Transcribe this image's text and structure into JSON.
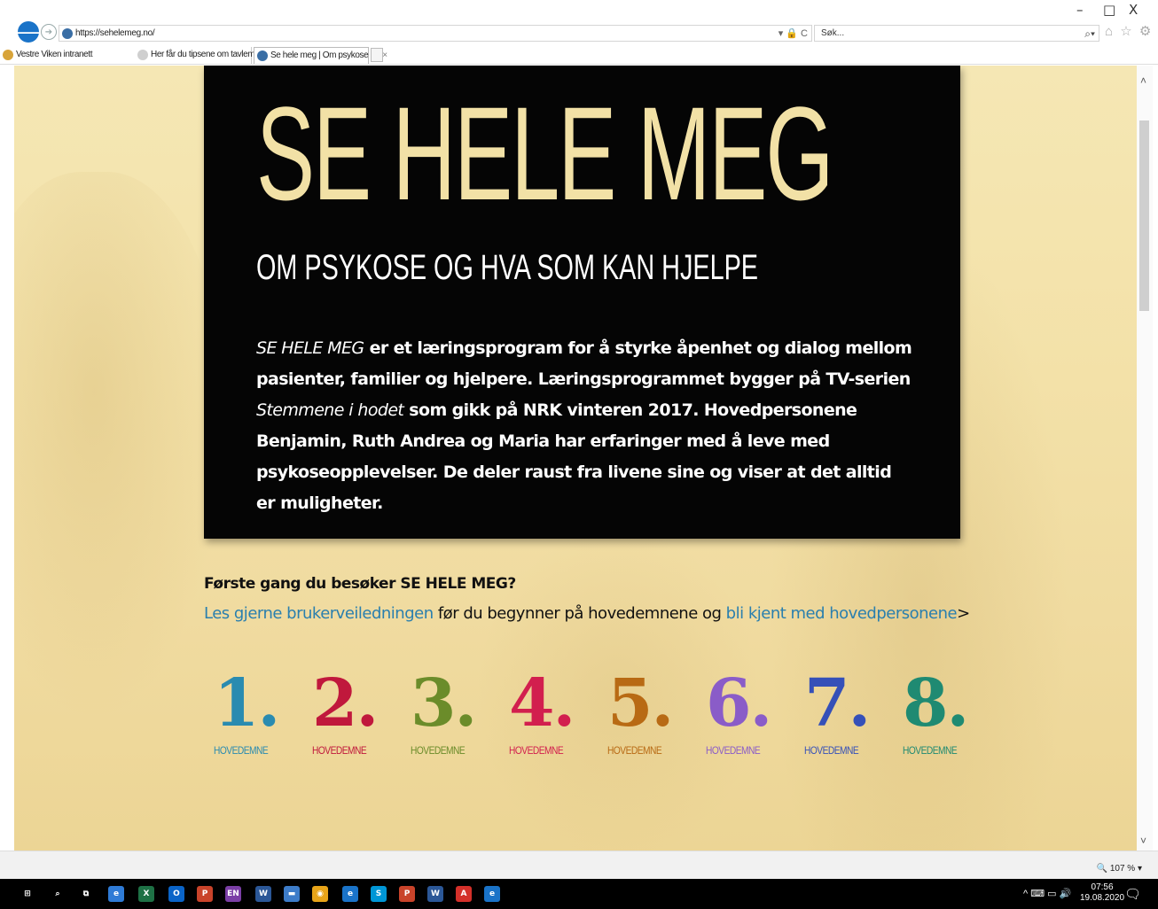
{
  "window_controls": {
    "minimize": "–",
    "maximize": "□",
    "close": "X"
  },
  "browser": {
    "url": "https://sehelemeg.no/",
    "address_controls": "▾ 🔒 C",
    "search_placeholder": "Søk...",
    "search_icon": "search-icon",
    "toolbar_icons": "⌂ ☆ ⚙",
    "tabs": [
      {
        "label": "Vestre Viken intranett",
        "icon": "ie-icon",
        "color": "#d8a43a"
      },
      {
        "label": "Her får du tipsene om tavlemø...",
        "icon": "page-icon",
        "color": "#aaaaaa"
      },
      {
        "label": "Se hele meg | Om psykose ...",
        "icon": "wordpress-icon",
        "color": "#3a6ea5",
        "active": true,
        "close": "×"
      }
    ]
  },
  "hero": {
    "title": "SE HELE MEG",
    "subtitle": "OM PSYKOSE OG HVA SOM KAN HJELPE",
    "text": {
      "p1_italic": "SE HELE MEG",
      "p2": " er et læringsprogram for å styrke åpenhet og dialog mellom pasienter, familier og hjelpere. Læringsprogrammet bygger på TV-serien ",
      "p3_italic": "Stemmene i hodet",
      "p4": " som gikk på NRK vinteren 2017. Hovedpersonene Benjamin, Ruth Andrea og Maria har erfaringer med å leve med psykoseopplevelser. De deler raust fra livene sine og viser at det alltid er muligheter."
    }
  },
  "intro": {
    "question": "Første gang du besøker SE HELE MEG?",
    "link1": "Les gjerne brukerveiledningen",
    "mid": " før du begynner på hovedemnene og ",
    "link2": "bli kjent med hovedpersonene",
    "arrow": ">"
  },
  "topics": [
    {
      "number": "1.",
      "label": "HOVEDEMNE",
      "color": "#2a8bb0"
    },
    {
      "number": "2.",
      "label": "HOVEDEMNE",
      "color": "#c0183c"
    },
    {
      "number": "3.",
      "label": "HOVEDEMNE",
      "color": "#6b8c2a"
    },
    {
      "number": "4.",
      "label": "HOVEDEMNE",
      "color": "#d21f4e"
    },
    {
      "number": "5.",
      "label": "HOVEDEMNE",
      "color": "#b86a14"
    },
    {
      "number": "6.",
      "label": "HOVEDEMNE",
      "color": "#8a5cc8"
    },
    {
      "number": "7.",
      "label": "HOVEDEMNE",
      "color": "#3550b8"
    },
    {
      "number": "8.",
      "label": "HOVEDEMNE",
      "color": "#1f8a72"
    }
  ],
  "statusbar": {
    "zoom": "🔍 107 %  ▾"
  },
  "taskbar": {
    "tray": "^ ⌨ ▭ 🔊",
    "time": "07:56",
    "date": "19.08.2020",
    "notifications": "🗨",
    "apps": [
      {
        "name": "windows-start-icon",
        "glyph": "⊞",
        "color": "#000000"
      },
      {
        "name": "search-icon",
        "glyph": "⌕",
        "color": "#000000"
      },
      {
        "name": "task-view-icon",
        "glyph": "⧉",
        "color": "#000000"
      },
      {
        "name": "edge-icon",
        "glyph": "e",
        "color": "#2f7bd6"
      },
      {
        "name": "excel-icon",
        "glyph": "X",
        "color": "#1e7145"
      },
      {
        "name": "outlook-icon",
        "glyph": "O",
        "color": "#0a64c8"
      },
      {
        "name": "powerpoint-icon",
        "glyph": "P",
        "color": "#c9432a"
      },
      {
        "name": "onenote-en-icon",
        "glyph": "EN",
        "color": "#7b3fa6"
      },
      {
        "name": "word-icon",
        "glyph": "W",
        "color": "#2b5797"
      },
      {
        "name": "file-explorer-icon",
        "glyph": "▬",
        "color": "#3d7cc9"
      },
      {
        "name": "chrome-icon",
        "glyph": "◉",
        "color": "#e8a419"
      },
      {
        "name": "ie-icon",
        "glyph": "e",
        "color": "#1a73c8"
      },
      {
        "name": "skype-icon",
        "glyph": "S",
        "color": "#0096d6"
      },
      {
        "name": "powerpoint2-icon",
        "glyph": "P",
        "color": "#c9432a"
      },
      {
        "name": "word2-icon",
        "glyph": "W",
        "color": "#2b5797"
      },
      {
        "name": "acrobat-icon",
        "glyph": "A",
        "color": "#d4302a"
      },
      {
        "name": "ie-active-icon",
        "glyph": "e",
        "color": "#1a73c8"
      }
    ]
  }
}
